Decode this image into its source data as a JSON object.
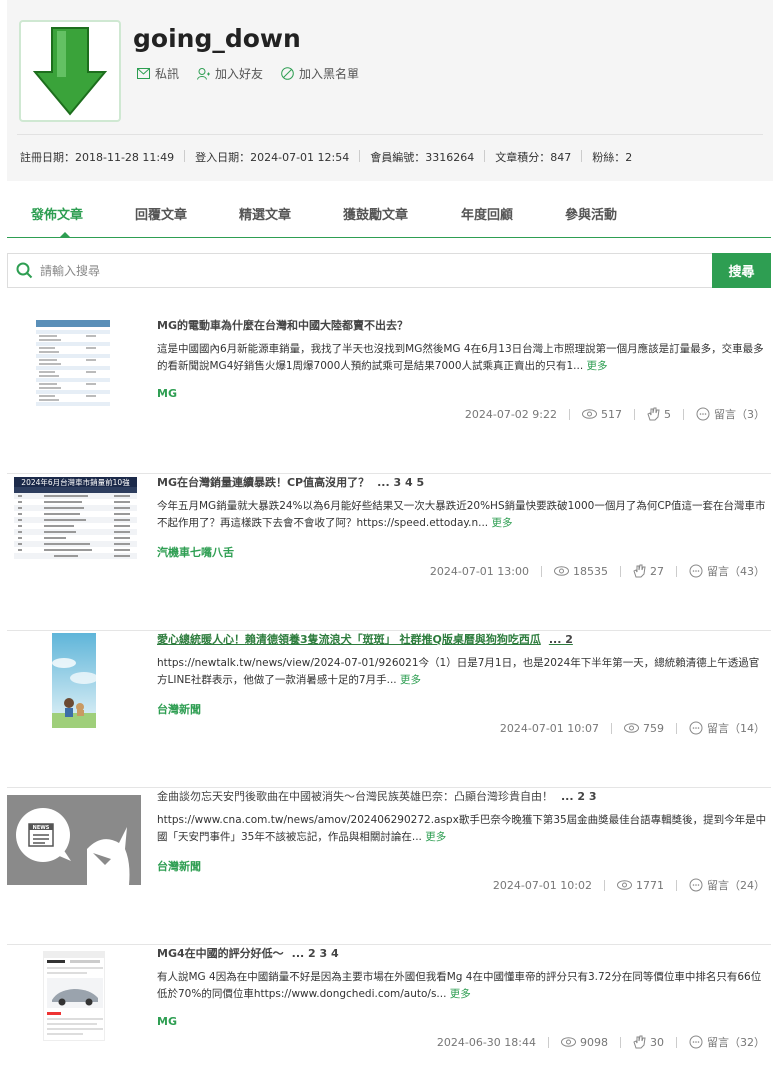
{
  "profile": {
    "username": "going_down",
    "actions": {
      "message": "私訊",
      "add_friend": "加入好友",
      "blacklist": "加入黑名單"
    },
    "stats": {
      "register": "註冊日期：2018-11-28 11:49",
      "login": "登入日期：2024-07-01 12:54",
      "member_no": "會員編號：3316264",
      "points": "文章積分：847",
      "fans": "粉絲：2"
    }
  },
  "tabs": [
    "發佈文章",
    "回覆文章",
    "精選文章",
    "獲鼓勵文章",
    "年度回顧",
    "參與活動"
  ],
  "search": {
    "placeholder": "請輸入搜尋",
    "button": "搜尋"
  },
  "posts": [
    {
      "title": "MG的電動車為什麼在台灣和中國大陸都賣不出去？",
      "pages": "",
      "excerpt": "這是中國國內6月新能源車銷量，我找了半天也沒找到MG然後MG 4在6月13日台灣上市照理說第一個月應該是訂量最多，交車最多的看新聞說MG4好銷售火爆1周爆7000人預約試乘可是結果7000人試乘真正賣出的只有1...",
      "more": "更多",
      "tag": "MG",
      "date": "2024-07-02 9:22",
      "views": "517",
      "likes": "5",
      "comments": "留言（3）"
    },
    {
      "title": "MG在台灣銷量連續暴跌！CP值高沒用了？",
      "pages": "... 3 4 5",
      "excerpt": "今年五月MG銷量就大暴跌24%以為6月能好些結果又一次大暴跌近20%HS銷量快要跌破1000一個月了為何CP值這一套在台灣車市不起作用了？再這樣跌下去會不會收了阿？https://speed.ettoday.n...",
      "more": "更多",
      "tag": "汽機車七嘴八舌",
      "date": "2024-07-01 13:00",
      "views": "18535",
      "likes": "27",
      "comments": "留言（43）",
      "table_title": "2024年6月台灣車市銷量前10強"
    },
    {
      "title": "愛心總統暖人心！賴清德領養3隻流浪犬「斑斑」 社群推Q版桌曆與狗狗吃西瓜",
      "pages": "... 2",
      "excerpt": "https://newtalk.tw/news/view/2024-07-01/926021今（1）日是7月1日，也是2024年下半年第一天，總統賴清德上午透過官方LINE社群表示，他做了一款消暑感十足的7月手...",
      "more": "更多",
      "tag": "台灣新聞",
      "date": "2024-07-01 10:07",
      "views": "759",
      "likes": "",
      "comments": "留言（14）"
    },
    {
      "title": "金曲談勿忘天安門後歌曲在中國被消失～台灣民族英雄巴奈：凸顯台灣珍貴自由！",
      "pages": "... 2 3",
      "excerpt": "https://www.cna.com.tw/news/amov/202406290272.aspx歌手巴奈今晚獲下第35屆金曲獎最佳台語專輯獎後，提到今年是中國「天安門事件」35年不該被忘記，作品與相關討論在...",
      "more": "更多",
      "tag": "台灣新聞",
      "date": "2024-07-01 10:02",
      "views": "1771",
      "likes": "",
      "comments": "留言（24）",
      "news_label": "NEWS"
    },
    {
      "title": "MG4在中國的評分好低～",
      "pages": "... 2 3 4",
      "excerpt": "有人說MG 4因為在中國銷量不好是因為主要市場在外國但我看Mg 4在中國懂車帝的評分只有3.72分在同等價位車中排名只有66位低於70%的同價位車https://www.dongchedi.com/auto/s...",
      "more": "更多",
      "tag": "MG",
      "date": "2024-06-30 18:44",
      "views": "9098",
      "likes": "30",
      "comments": "留言（32）"
    }
  ]
}
